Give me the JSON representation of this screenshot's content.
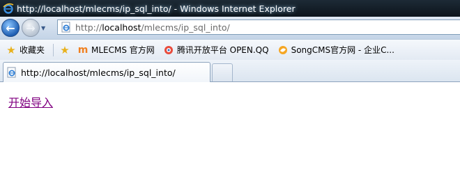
{
  "window": {
    "title": "http://localhost/mlecms/ip_sql_into/ - Windows Internet Explorer"
  },
  "address_bar": {
    "url_prefix": "http://",
    "url_host": "localhost",
    "url_path": "/mlecms/ip_sql_into/"
  },
  "favorites": {
    "label": "收藏夹",
    "items": [
      {
        "label": "MLECMS 官方网",
        "icon": "mlecms-logo-icon"
      },
      {
        "label": "腾讯开放平台 OPEN.QQ",
        "icon": "qq-logo-icon"
      },
      {
        "label": "SongCMS官方网 - 企业C...",
        "icon": "songcms-logo-icon"
      }
    ]
  },
  "tabs": [
    {
      "label": "http://localhost/mlecms/ip_sql_into/",
      "active": true
    }
  ],
  "page": {
    "link_text": "开始导入",
    "link_color": "#800080"
  }
}
